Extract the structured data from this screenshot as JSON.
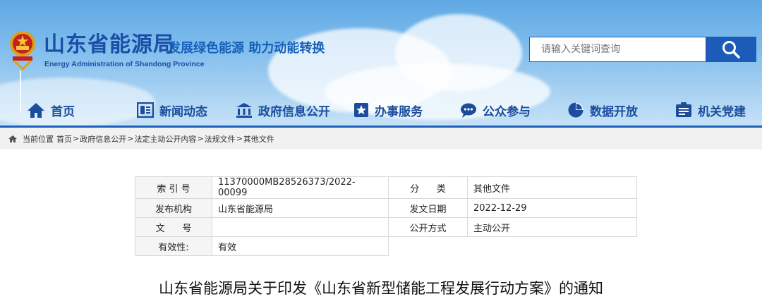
{
  "header": {
    "title_cn": "山东省能源局",
    "title_en": "Energy Administration of Shandong Province",
    "slogan": "发展绿色能源  助力动能转换",
    "brand_color": "#1a4fa6"
  },
  "search": {
    "placeholder": "请输入关键词查询",
    "button_icon": "search-icon"
  },
  "nav": {
    "items": [
      {
        "label": "首页",
        "icon": "home-icon"
      },
      {
        "label": "新闻动态",
        "icon": "newspaper-icon"
      },
      {
        "label": "政府信息公开",
        "icon": "government-building-icon"
      },
      {
        "label": "办事服务",
        "icon": "star-service-icon"
      },
      {
        "label": "公众参与",
        "icon": "chat-bubble-icon"
      },
      {
        "label": "数据开放",
        "icon": "pie-chart-icon"
      },
      {
        "label": "机关党建",
        "icon": "party-building-icon"
      }
    ]
  },
  "breadcrumb": {
    "prefix": "当前位置",
    "items": [
      "首页",
      "政府信息公开",
      "法定主动公开内容",
      "法规文件",
      "其他文件"
    ],
    "separator": ">"
  },
  "meta": {
    "index_label": "索 引 号",
    "index_value": "11370000MB28526373/2022-00099",
    "category_label": "分      类",
    "category_value": "其他文件",
    "publisher_label": "发布机构",
    "publisher_value": "山东省能源局",
    "date_label": "发文日期",
    "date_value": "2022-12-29",
    "docno_label": "文      号",
    "docno_value": "",
    "openness_label": "公开方式",
    "openness_value": "主动公开",
    "validity_label": "有效性:",
    "validity_value": "有效"
  },
  "article": {
    "title": "山东省能源局关于印发《山东省新型储能工程发展行动方案》的通知"
  }
}
